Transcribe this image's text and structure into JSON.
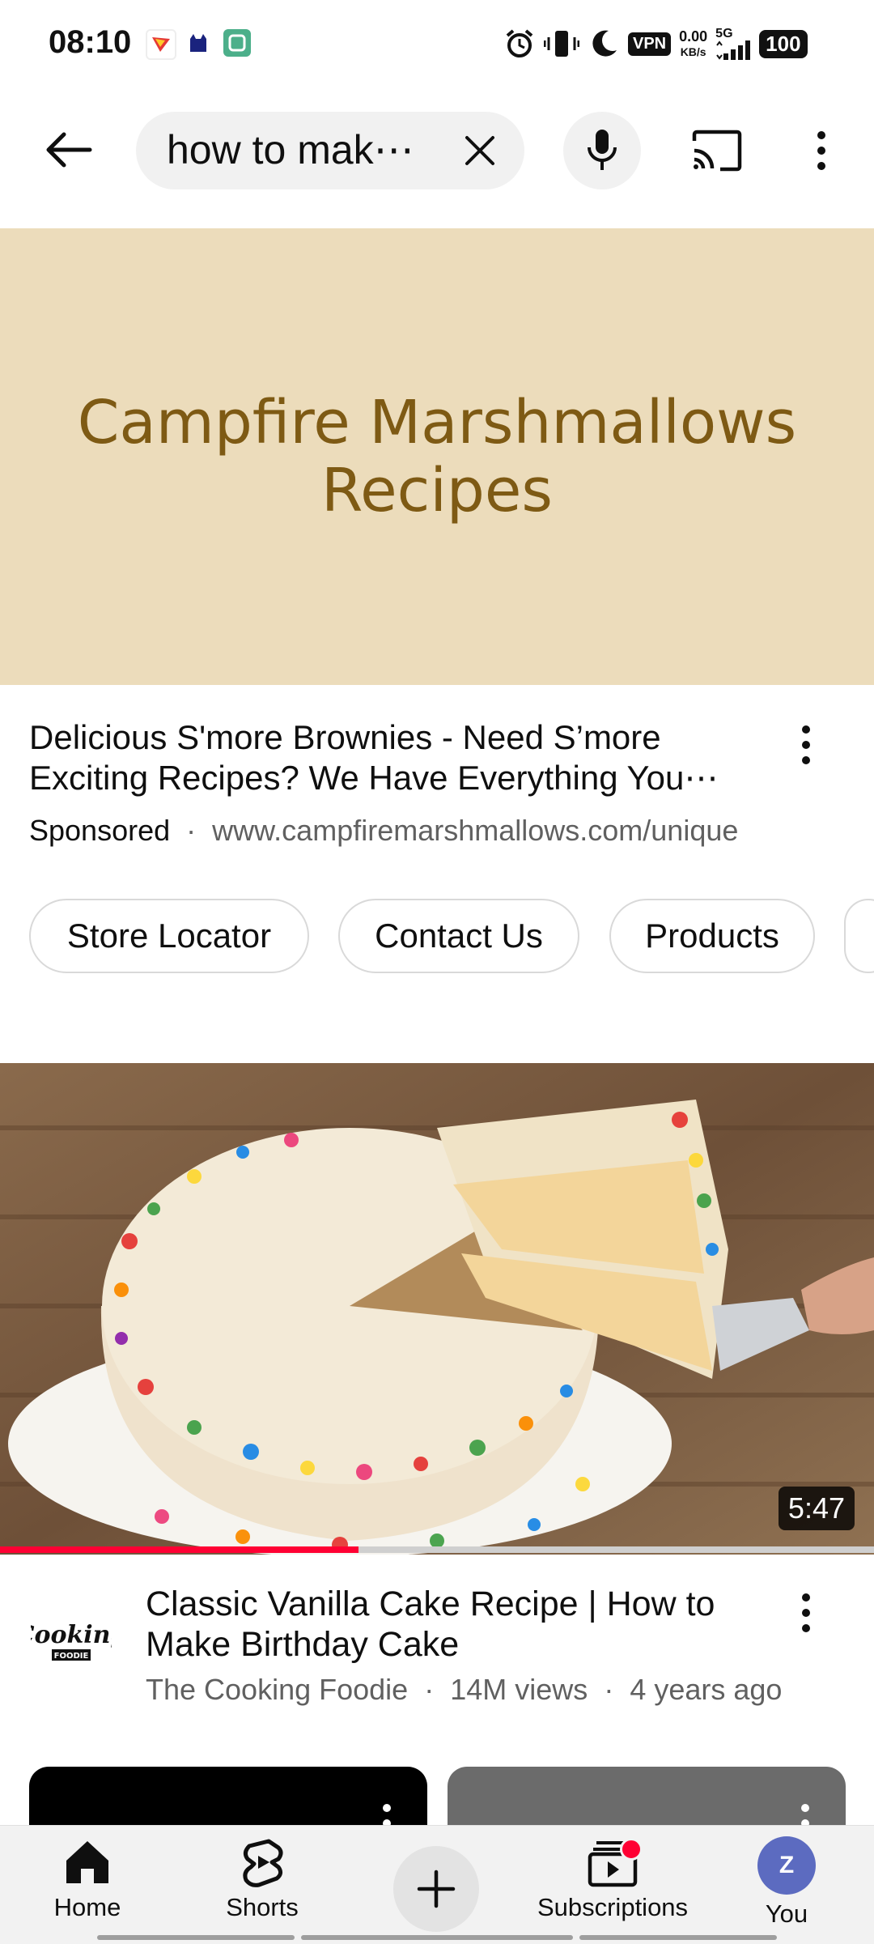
{
  "status_bar": {
    "time": "08:10",
    "vpn": "VPN",
    "net_speed_value": "0.00",
    "net_speed_unit": "KB/s",
    "network": "5G",
    "battery": "100"
  },
  "app_bar": {
    "search_query": "how to mak⋯"
  },
  "ad": {
    "banner_title": "Campfire Marshmallows Recipes",
    "headline": "Delicious S'more Brownies - Need S’more Exciting Recipes? We Have Everything You⋯",
    "sponsored_label": "Sponsored",
    "separator": "·",
    "url": "www.campfiremarshmallows.com/unique",
    "chips": [
      "Store Locator",
      "Contact Us",
      "Products"
    ]
  },
  "video": {
    "duration": "5:47",
    "progress_fraction": 0.41,
    "title": "Classic Vanilla Cake Recipe | How to Make Birthday Cake",
    "channel": "The Cooking Foodie",
    "views": "14M views",
    "age": "4 years ago",
    "separator": "·"
  },
  "bottom_nav": {
    "home": "Home",
    "shorts": "Shorts",
    "subscriptions": "Subscriptions",
    "you": "You",
    "avatar_letter": "Z"
  },
  "colors": {
    "accent_red": "#ff0033",
    "banner_bg": "#ecdcbb",
    "banner_text": "#7e5a14",
    "avatar_bg": "#5c6bc0"
  }
}
